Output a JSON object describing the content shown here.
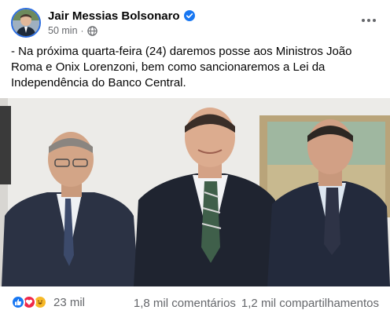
{
  "post": {
    "author": "Jair Messias Bolsonaro",
    "time": "50 min",
    "separator": "·",
    "text": "- Na próxima quarta-feira (24) daremos posse aos Ministros João Roma e Onix Lorenzoni, bem como sancionaremos a Lei da Independência do Banco Central.",
    "icons": {
      "verified": "verified-badge-icon",
      "audience": "globe-icon",
      "more": "more-options-icon"
    }
  },
  "footer": {
    "reactions": [
      "like",
      "love",
      "haha"
    ],
    "reaction_count": "23 mil",
    "comments": "1,8 mil comentários",
    "shares": "1,2 mil compartilhamentos"
  },
  "colors": {
    "accent": "#1877f2",
    "love": "#f02849",
    "haha": "#f7b928",
    "muted_text": "#65676b"
  }
}
